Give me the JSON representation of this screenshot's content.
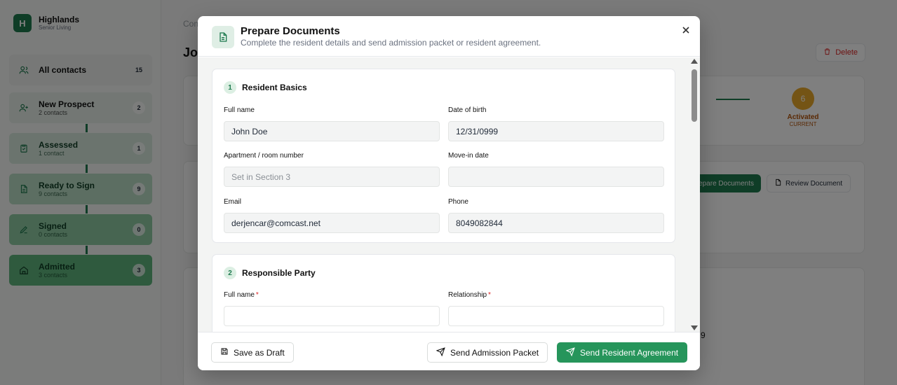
{
  "brand": {
    "name": "Highlands",
    "subtitle": "Senior Living",
    "logo_letter": "H"
  },
  "sidebar": {
    "all_contacts": {
      "label": "All contacts",
      "count": "15"
    },
    "stages": [
      {
        "name": "New Prospect",
        "sub": "2 contacts",
        "count": "2"
      },
      {
        "name": "Assessed",
        "sub": "1 contact",
        "count": "1"
      },
      {
        "name": "Ready to Sign",
        "sub": "9 contacts",
        "count": "9"
      },
      {
        "name": "Signed",
        "sub": "0 contacts",
        "count": "0"
      },
      {
        "name": "Admitted",
        "sub": "3 contacts",
        "count": "3"
      }
    ]
  },
  "background": {
    "breadcrumb": "Con",
    "title": "Jo",
    "delete_label": "Delete",
    "step_number": "6",
    "step_label": "Activated",
    "step_status": "CURRENT",
    "prepare_label": "epare Documents",
    "review_label": "Review Document",
    "stray_text": "9"
  },
  "modal": {
    "title": "Prepare Documents",
    "subtitle": "Complete the resident details and send admission packet or resident agreement.",
    "section1": {
      "number": "1",
      "title": "Resident Basics",
      "full_name": {
        "label": "Full name",
        "value": "John Doe"
      },
      "dob": {
        "label": "Date of birth",
        "value": "12/31/0999"
      },
      "apartment": {
        "label": "Apartment / room number",
        "placeholder": "Set in Section 3"
      },
      "move_in": {
        "label": "Move-in date",
        "value": ""
      },
      "email": {
        "label": "Email",
        "value": "derjencar@comcast.net"
      },
      "phone": {
        "label": "Phone",
        "value": "8049082844"
      }
    },
    "section2": {
      "number": "2",
      "title": "Responsible Party",
      "full_name": {
        "label": "Full name",
        "required": "*",
        "value": ""
      },
      "relationship": {
        "label": "Relationship",
        "required": "*",
        "value": ""
      }
    },
    "footer": {
      "save_draft": "Save as Draft",
      "send_packet": "Send Admission Packet",
      "send_agreement": "Send Resident Agreement"
    }
  },
  "colors": {
    "accent": "#26955b",
    "danger": "#dc2626",
    "warning": "#e9a82b"
  }
}
